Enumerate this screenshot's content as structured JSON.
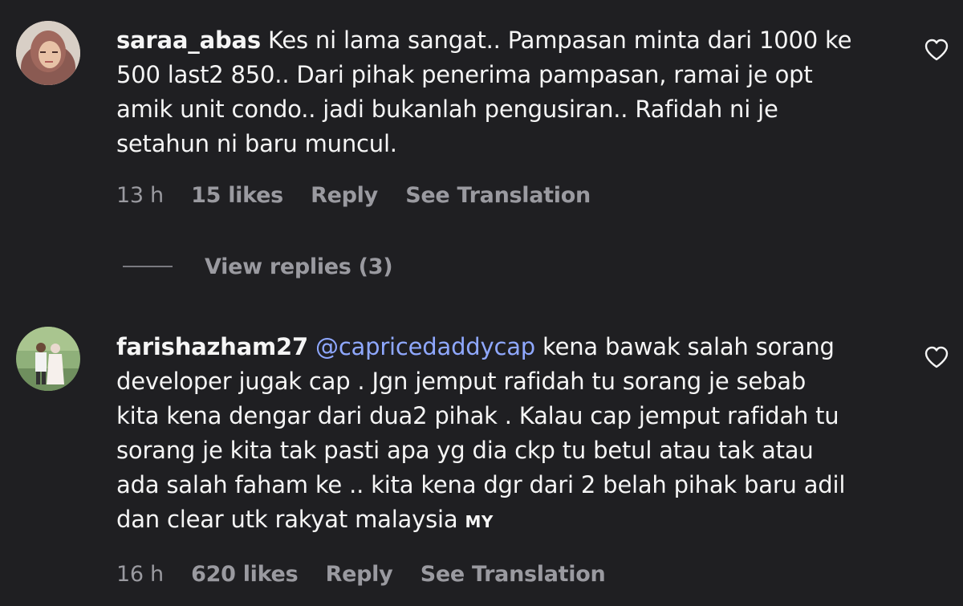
{
  "comments": [
    {
      "username": "saraa_abas",
      "text_lines": [
        "Kes ni lama sangat.. Pampasan minta dari 1000 ke",
        "500 last2 850.. Dari pihak penerima pampasan, ramai je opt",
        "amik unit condo.. jadi bukanlah pengusiran.. Rafidah ni je",
        "setahun ni baru muncul."
      ],
      "time": "13 h",
      "likes": "15 likes",
      "reply": "Reply",
      "translate": "See Translation",
      "view_replies": "View replies (3)"
    },
    {
      "username": "farishazham27",
      "mention": "@capricedaddycap",
      "text_first_rest": "kena bawak salah sorang",
      "text_lines": [
        "developer jugak cap . Jgn jemput rafidah tu sorang je sebab",
        "kita kena dengar dari dua2 pihak . Kalau cap jemput rafidah tu",
        "sorang je kita tak pasti apa yg dia ckp tu betul atau tak atau",
        "ada salah faham ke .. kita kena dgr dari 2 belah pihak baru adil",
        "dan clear utk rakyat malaysia"
      ],
      "flag": "MY",
      "time": "16 h",
      "likes": "620 likes",
      "reply": "Reply",
      "translate": "See Translation"
    }
  ],
  "icons": {
    "like": "heart-outline-icon"
  },
  "colors": {
    "background": "#1f1f22",
    "text": "#f5f5f5",
    "secondary": "#9a9aa0",
    "mention": "#8fa8ff"
  }
}
